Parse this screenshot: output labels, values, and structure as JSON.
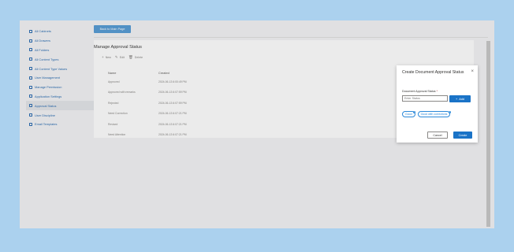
{
  "sidebar": {
    "items": [
      {
        "label": "All Cabinets",
        "icon": "cabinet-icon"
      },
      {
        "label": "All Drawers",
        "icon": "drawer-icon"
      },
      {
        "label": "All Folders",
        "icon": "folder-icon"
      },
      {
        "label": "All Content Types",
        "icon": "content-type-icon"
      },
      {
        "label": "All Content Type Values",
        "icon": "content-value-icon"
      },
      {
        "label": "User Management",
        "icon": "user-icon"
      },
      {
        "label": "Manage Permission",
        "icon": "permission-icon"
      },
      {
        "label": "Application Settings",
        "icon": "settings-icon"
      },
      {
        "label": "Approval Status",
        "icon": "approval-icon",
        "active": true
      },
      {
        "label": "User Discipline",
        "icon": "discipline-icon"
      },
      {
        "label": "Email Templates",
        "icon": "email-icon"
      }
    ]
  },
  "back_button": "Back to Main Page",
  "main": {
    "title": "Manage Approval Status",
    "commands": {
      "new": "New",
      "edit": "Edit",
      "delete": "Delete"
    },
    "table": {
      "headers": [
        "Name",
        "Created"
      ],
      "rows": [
        [
          "Approved",
          "2024-06-13 6:00:49 PM"
        ],
        [
          "Approved with remarks",
          "2024-06-13 6:07:59 PM"
        ],
        [
          "Rejected",
          "2024-06-13 6:07:59 PM"
        ],
        [
          "Need Correction",
          "2024-06-13 6:07:21 PM"
        ],
        [
          "Revised",
          "2024-06-13 6:07:21 PM"
        ],
        [
          "Need Attention",
          "2024-06-13 6:07:21 PM"
        ]
      ]
    }
  },
  "dialog": {
    "title": "Create Document Approval Status",
    "field_label": "Document Approval Status",
    "required_mark": "*",
    "input_placeholder": "Enter Status",
    "add_label": "Add",
    "chips": [
      "Good",
      "Good with corrections"
    ],
    "cancel_label": "Cancel",
    "create_label": "Create"
  },
  "colors": {
    "backdrop": "#abd1ee",
    "primary": "#1a73c7",
    "link": "#2f6fb3"
  }
}
